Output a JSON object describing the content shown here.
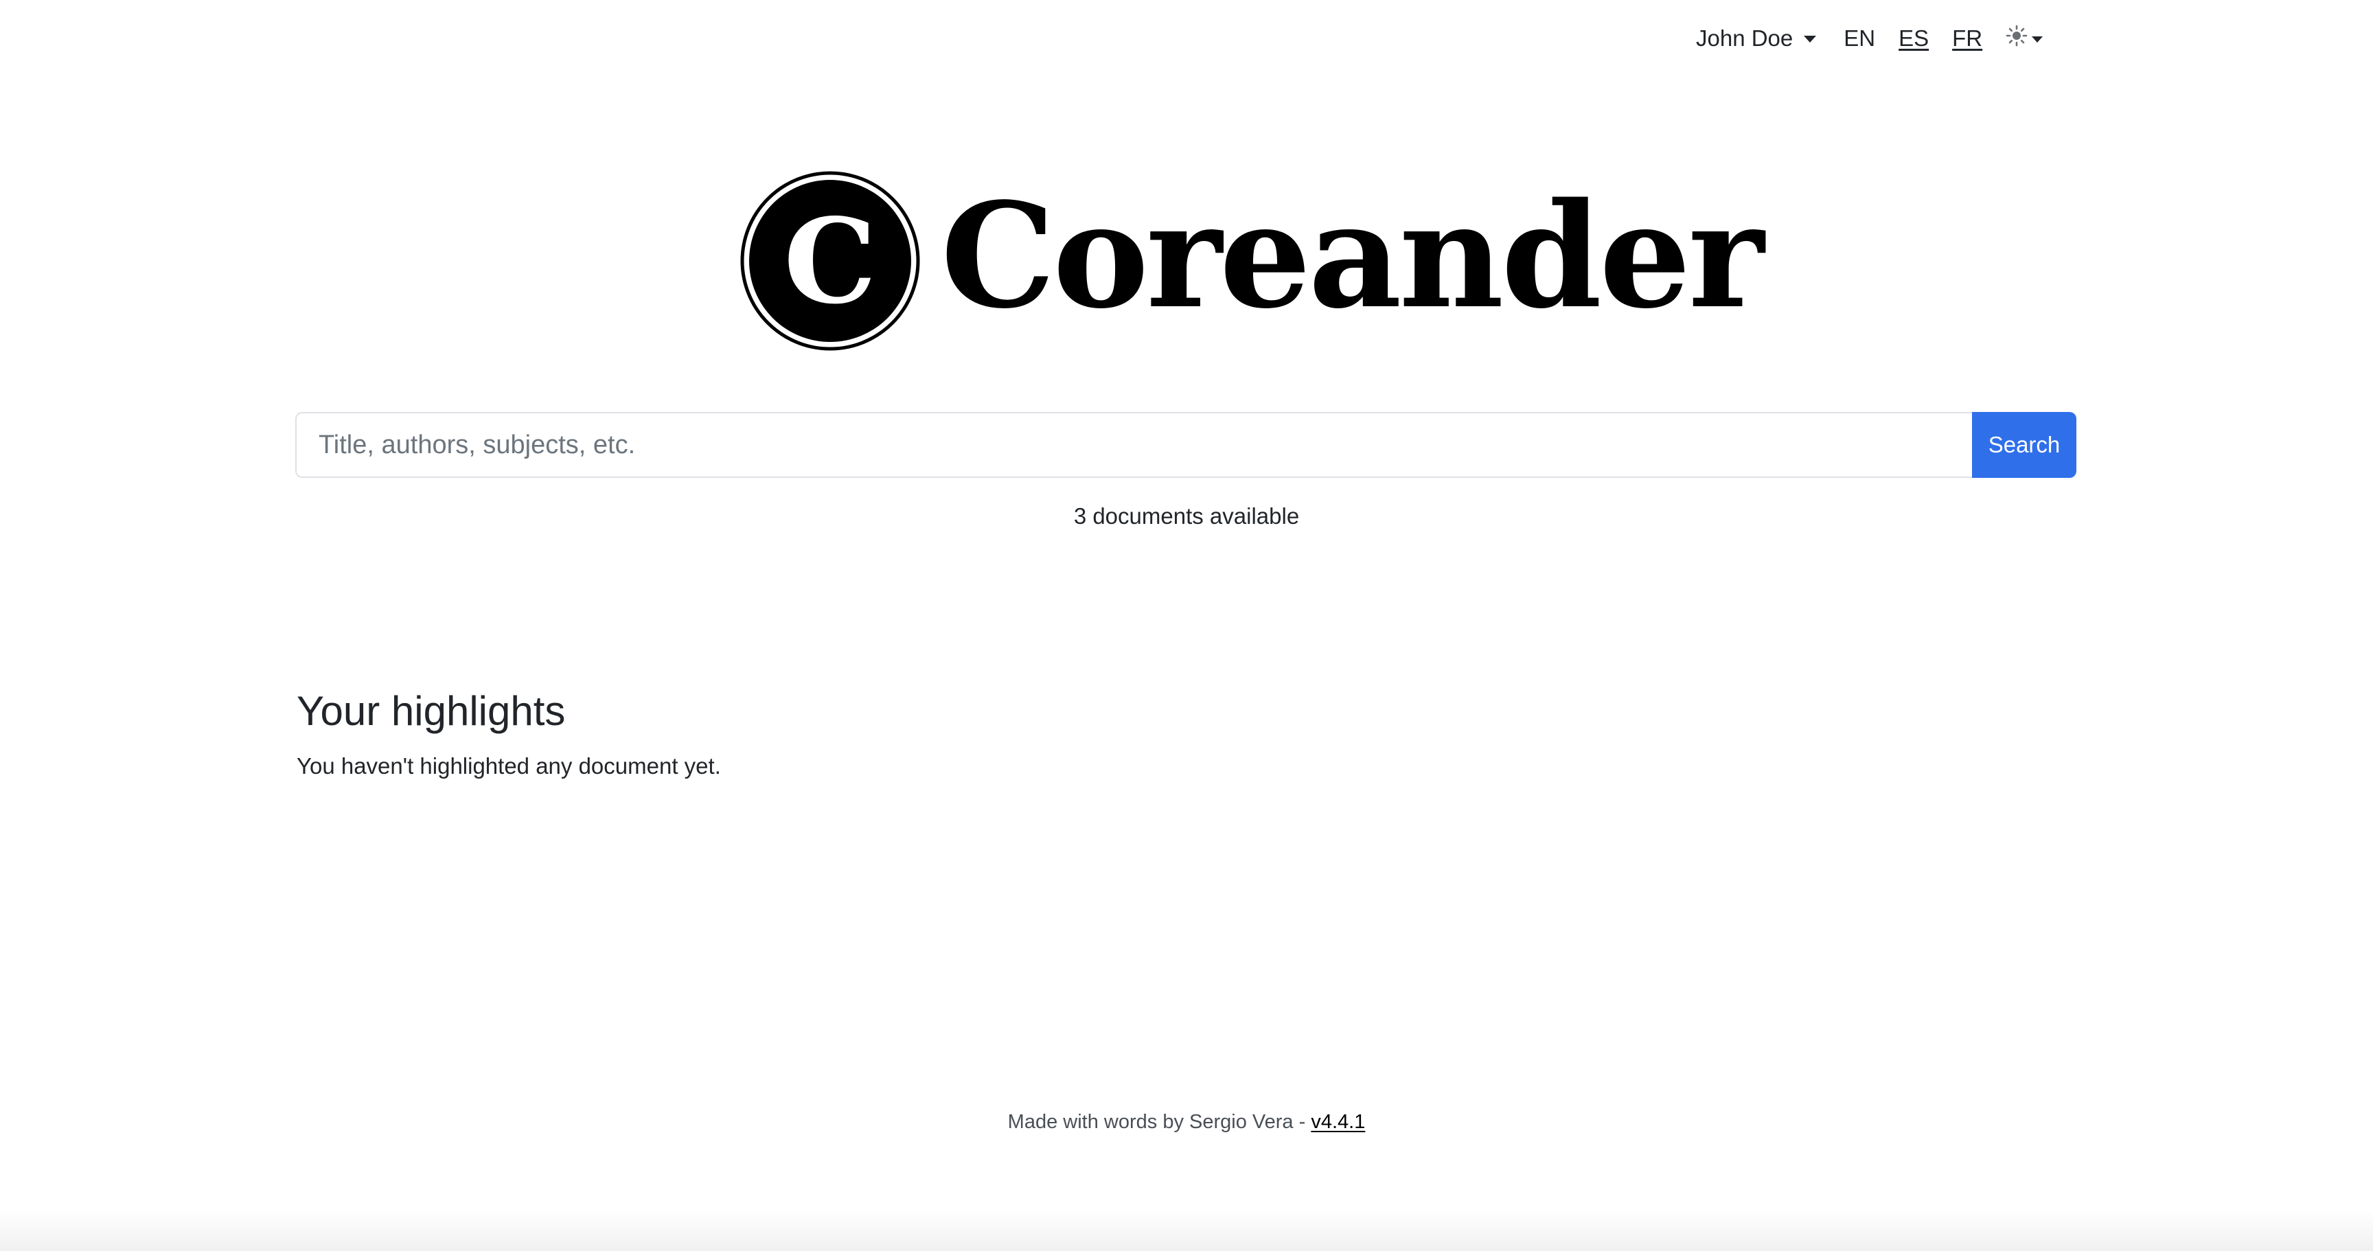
{
  "header": {
    "user_name": "John Doe",
    "languages": [
      "EN",
      "ES",
      "FR"
    ],
    "theme_icon": "sun-icon"
  },
  "logo": {
    "letter": "C",
    "text": "Coreander"
  },
  "search": {
    "placeholder": "Title, authors, subjects, etc.",
    "button_label": "Search",
    "button_color": "#2f6fea"
  },
  "documents_available": "3 documents available",
  "highlights": {
    "title": "Your highlights",
    "empty_message": "You haven't highlighted any document yet."
  },
  "footer": {
    "text": "Made with words by Sergio Vera - ",
    "version": "v4.4.1"
  }
}
